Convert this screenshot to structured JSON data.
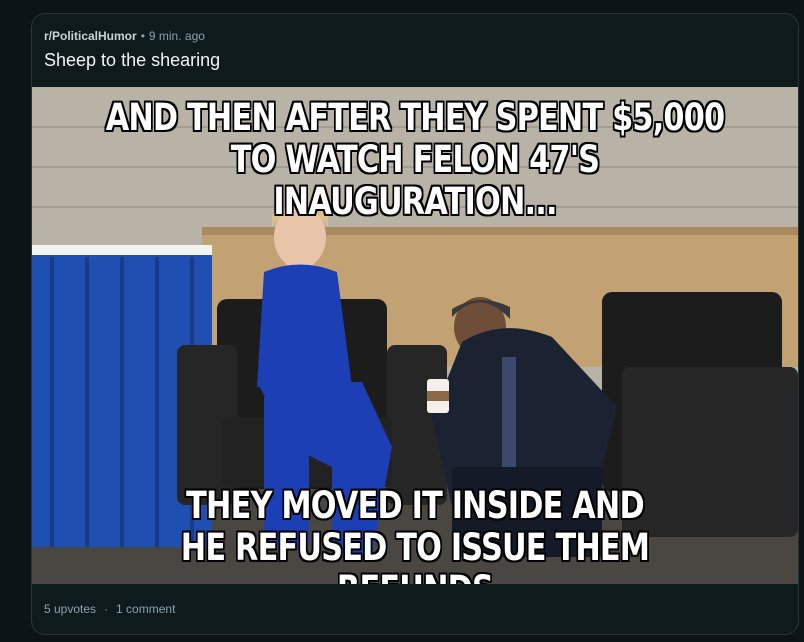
{
  "post": {
    "subreddit": "r/PoliticalHumor",
    "separator": "•",
    "time_ago": "9 min. ago",
    "title": "Sheep to the shearing",
    "meme": {
      "top_line_1": "AND THEN AFTER THEY SPENT $5,000",
      "top_line_2": "TO WATCH FELON 47'S INAUGURATION...",
      "bottom_line_1": "THEY MOVED IT INSIDE AND",
      "bottom_line_2": "HE REFUSED TO ISSUE THEM REFUNDS"
    },
    "upvotes": "5 upvotes",
    "footer_separator": "·",
    "comments": "1 comment"
  }
}
